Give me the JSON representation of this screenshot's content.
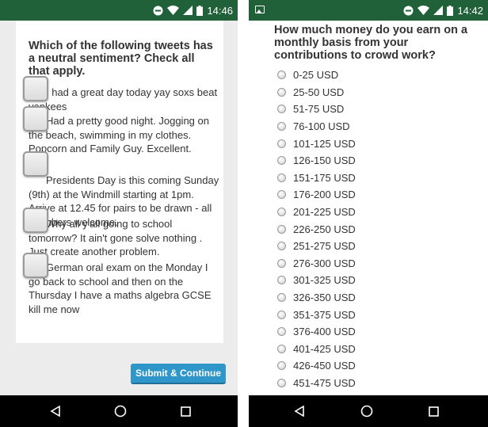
{
  "left_screen": {
    "status_time": "14:46",
    "question": "Which of the following tweets has a neutral sentiment? Check all that apply.",
    "tweets": [
      {
        "text": "I had a great day today yay soxs beat yankees"
      },
      {
        "text": "Had a pretty good night. Jogging on the beach, swimming in my clothes. Popcorn and Family Guy. Excellent."
      },
      {
        "text": "Presidents Day is this coming Sunday (9th) at the Windmill starting at 1pm. Arrive at 12.45 for pairs to be drawn - all Members welcome."
      },
      {
        "text": "Why all y'all going to school tomorrow? It ain't gone solve nothing . Just create another problem."
      },
      {
        "text": "German oral exam on the Monday I go back to school and then on the Thursday I have a maths algebra GCSE kill me now"
      }
    ],
    "submit_label": "Submit & Continue"
  },
  "right_screen": {
    "status_time": "14:42",
    "question": "How much money do you earn on a monthly basis from your contributions to crowd work?",
    "options": [
      "0-25 USD",
      "25-50 USD",
      "51-75 USD",
      "76-100 USD",
      "101-125 USD",
      "126-150 USD",
      "151-175 USD",
      "176-200 USD",
      "201-225 USD",
      "226-250 USD",
      "251-275 USD",
      "276-300 USD",
      "301-325 USD",
      "326-350 USD",
      "351-375 USD",
      "376-400 USD",
      "401-425 USD",
      "426-450 USD",
      "451-475 USD"
    ]
  },
  "icons": [
    "notification-image-icon",
    "dnd-icon",
    "wifi-icon",
    "signal-icon",
    "battery-icon",
    "back-icon",
    "home-icon",
    "recents-icon"
  ],
  "colors": {
    "status_bar": "#20613a",
    "submit_button": "#2e96c8",
    "nav_bar": "#000000"
  }
}
